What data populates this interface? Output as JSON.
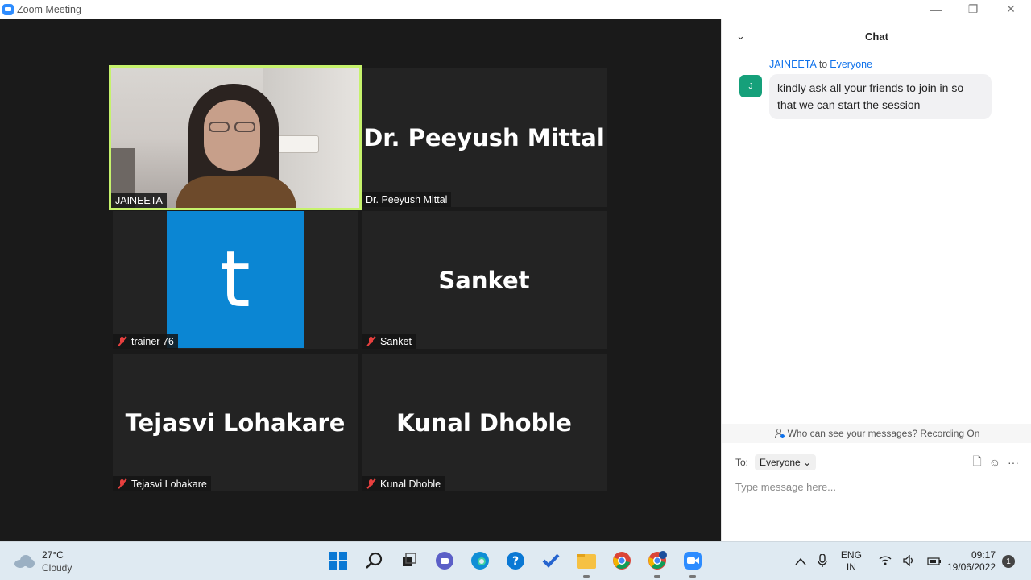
{
  "window": {
    "title": "Zoom Meeting",
    "minimize": "—",
    "restore": "❐",
    "close": "✕"
  },
  "participants": [
    {
      "display_name": "",
      "label": "JAINEETA",
      "active": true
    },
    {
      "display_name": "Dr. Peeyush Mittal",
      "label": "Dr. Peeyush Mittal",
      "muted": false
    },
    {
      "display_name": "t",
      "label": "trainer 76",
      "muted": true
    },
    {
      "display_name": "Sanket",
      "label": "Sanket",
      "muted": true
    },
    {
      "display_name": "Tejasvi Lohakare",
      "label": "Tejasvi Lohakare",
      "muted": true
    },
    {
      "display_name": "Kunal Dhoble",
      "label": "Kunal Dhoble",
      "muted": true
    }
  ],
  "chat": {
    "title": "Chat",
    "collapse_icon": "⌄",
    "message": {
      "sender": "JAINEETA",
      "to_word": "to",
      "target": "Everyone",
      "avatar_letter": "J",
      "text": "kindly ask all your friends to join in so that we can start the session"
    },
    "visibility_notice": "Who can see your messages? Recording On",
    "to_label": "To:",
    "to_value": "Everyone ⌄",
    "input_placeholder": "Type message here...",
    "tools": {
      "file": "🗋",
      "emoji": "☺",
      "more": "···"
    }
  },
  "taskbar": {
    "weather_temp": "27°C",
    "weather_cond": "Cloudy",
    "apps": [
      "start-icon",
      "search-icon",
      "task-view-icon",
      "chat-app-icon",
      "edge-icon",
      "help-icon",
      "todo-icon",
      "file-explorer-icon",
      "chrome-icon",
      "chrome-profile-icon",
      "zoom-icon"
    ],
    "lang_top": "ENG",
    "lang_bottom": "IN",
    "time": "09:17",
    "date": "19/06/2022",
    "notifications": "1"
  }
}
